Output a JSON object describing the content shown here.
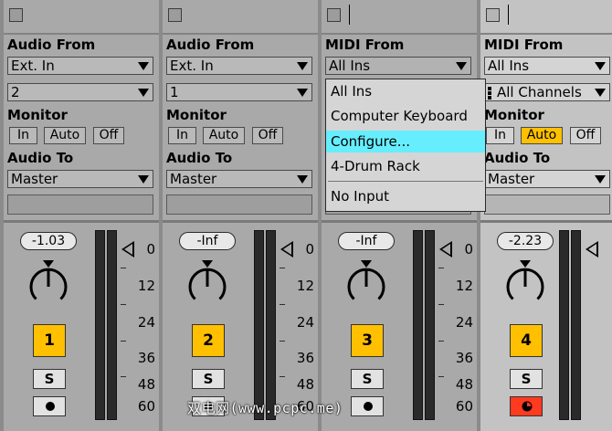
{
  "tracks": [
    {
      "input_label": "Audio From",
      "input_type": "Ext. In",
      "input_channel": "2",
      "monitor_label": "Monitor",
      "monitor_options": [
        "In",
        "Auto",
        "Off"
      ],
      "monitor_active": "Off",
      "output_label": "Audio To",
      "output": "Master",
      "volume": "-1.03",
      "number": "1",
      "solo": "S",
      "armed": false
    },
    {
      "input_label": "Audio From",
      "input_type": "Ext. In",
      "input_channel": "1",
      "monitor_label": "Monitor",
      "monitor_options": [
        "In",
        "Auto",
        "Off"
      ],
      "monitor_active": "Off",
      "output_label": "Audio To",
      "output": "Master",
      "volume": "-Inf",
      "number": "2",
      "solo": "S",
      "armed": false
    },
    {
      "input_label": "MIDI From",
      "input_type": "All Ins",
      "volume": "-Inf",
      "number": "3",
      "solo": "S",
      "armed": false
    },
    {
      "input_label": "MIDI From",
      "input_type": "All Ins",
      "input_channel": "All Channels",
      "monitor_label": "Monitor",
      "monitor_options": [
        "In",
        "Auto",
        "Off"
      ],
      "monitor_active": "Auto",
      "output_label": "Audio To",
      "output": "Master",
      "volume": "-2.23",
      "number": "4",
      "solo": "S",
      "armed": true
    }
  ],
  "meter_scale": [
    "0",
    "12",
    "24",
    "36",
    "48",
    "60"
  ],
  "midi_menu": {
    "items": [
      "All Ins",
      "Computer Keyboard",
      "Configure...",
      "4-Drum Rack",
      "No Input"
    ],
    "highlighted": "Configure..."
  },
  "watermark": "双电网(www.pcpc.me)",
  "colors": {
    "track_bg": "#a9a9a9",
    "selected_track_bg": "#c3c3c3",
    "active_yellow": "#ffc000",
    "arm_red": "#ff3b1f",
    "menu_highlight": "#66eeff"
  }
}
